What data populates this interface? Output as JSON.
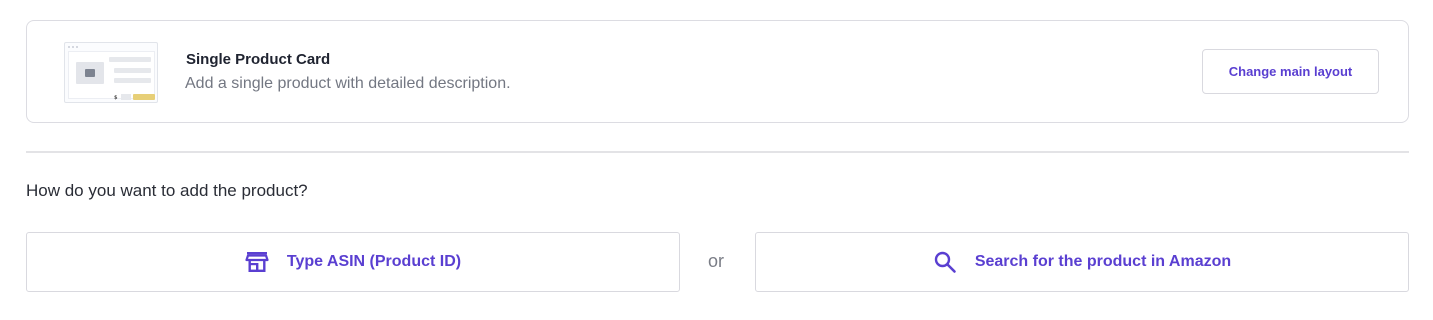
{
  "layout_card": {
    "title": "Single Product Card",
    "description": "Add a single product with detailed description.",
    "change_button_label": "Change main layout",
    "thumbnail_price_symbol": "$"
  },
  "question": "How do you want to add the product?",
  "options": {
    "asin_label": "Type ASIN (Product ID)",
    "asin_icon": "store-icon",
    "or_label": "or",
    "amazon_label": "Search for the product in Amazon",
    "amazon_icon": "search-icon"
  },
  "colors": {
    "accent": "#5a3fd1",
    "border": "#d9d9df",
    "muted_text": "#737782"
  }
}
